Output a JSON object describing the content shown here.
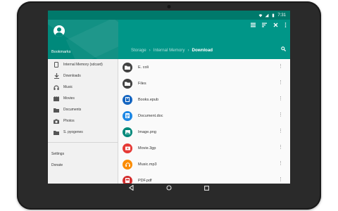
{
  "status_bar": {
    "time": "7:31"
  },
  "drawer": {
    "title": "Bookmarks",
    "items": [
      {
        "label": "Internal Memory (sdcard)",
        "icon": "phone-icon"
      },
      {
        "label": "Downloads",
        "icon": "download-icon"
      },
      {
        "label": "Music",
        "icon": "headphones-icon"
      },
      {
        "label": "Movies",
        "icon": "movie-icon"
      },
      {
        "label": "Documents",
        "icon": "folder-icon"
      },
      {
        "label": "Photos",
        "icon": "camera-icon"
      },
      {
        "label": "S. pyogenes",
        "icon": "folder-icon"
      }
    ],
    "settings_label": "Settings",
    "donate_label": "Donate"
  },
  "breadcrumb": [
    "Storage",
    "Internal Memory",
    "Download"
  ],
  "files": [
    {
      "name": "E. coli",
      "type": "folder",
      "color": "#424242"
    },
    {
      "name": "Files",
      "type": "folder",
      "color": "#424242"
    },
    {
      "name": "Books.epub",
      "type": "book",
      "color": "#1565c0"
    },
    {
      "name": "Document.doc",
      "type": "document",
      "color": "#1e88e5"
    },
    {
      "name": "Image.png",
      "type": "image",
      "color": "#00897b"
    },
    {
      "name": "Movie.3gp",
      "type": "video",
      "color": "#e53935"
    },
    {
      "name": "Music.mp3",
      "type": "audio",
      "color": "#fb8c00"
    },
    {
      "name": "PDF.pdf",
      "type": "pdf",
      "color": "#d32f2f"
    }
  ],
  "colors": {
    "primary": "#009688",
    "primary_dark": "#00796b"
  }
}
